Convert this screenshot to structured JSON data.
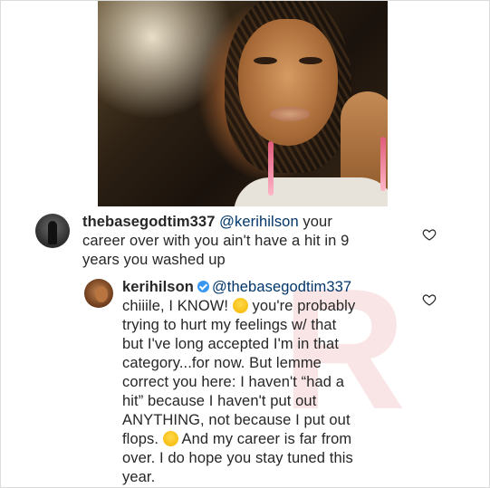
{
  "post": {
    "photo_alt": "post-photo",
    "watermark": "R"
  },
  "comments": [
    {
      "username": "thebasegodtim337",
      "mention": "@kerihilson",
      "line1_tail": " your",
      "line2": "career over with you ain't have a hit in 9",
      "line3": "years you washed up",
      "like_icon": "heart-outline-icon"
    },
    {
      "username": "kerihilson",
      "verified_icon": "verified-badge-icon",
      "mention": "@thebasegodtim337",
      "lines": {
        "l1a": "chiiile, I KNOW! ",
        "l1b": " you're probably",
        "l2": "trying to hurt my feelings w/ that",
        "l3": "but I've long accepted I'm in that",
        "l4": "category...for now. But lemme",
        "l5": "correct you here: I haven't “had a",
        "l6": "hit” because I haven't put out",
        "l7": "ANYTHING, not because I put out",
        "l8a": "flops. ",
        "l8b": " And my career is far from",
        "l9": "over. I do hope you stay tuned this",
        "l10": "year."
      },
      "emoji1": "laughing-crying-emoji",
      "emoji2": "winking-emoji",
      "like_icon": "heart-outline-icon"
    }
  ]
}
